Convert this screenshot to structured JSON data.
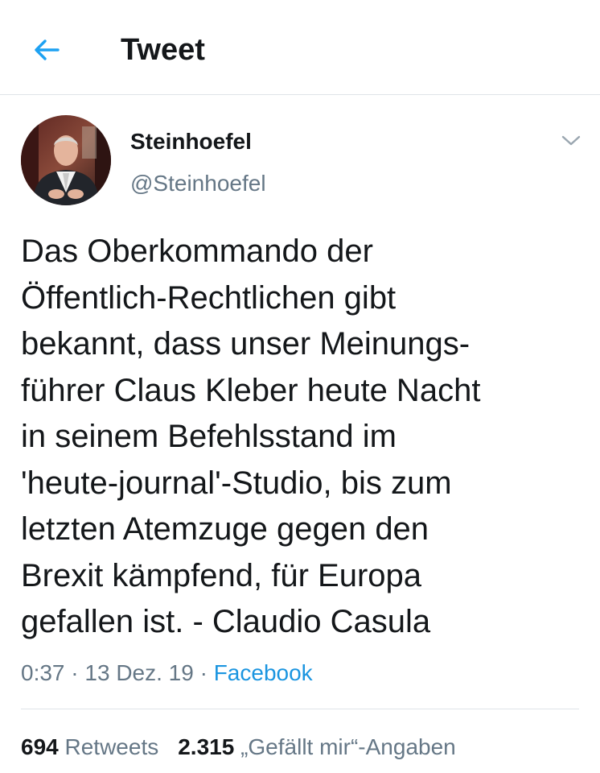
{
  "header": {
    "title": "Tweet",
    "back_icon": "arrow-left-icon",
    "accent_color": "#1da1f2"
  },
  "author": {
    "name": "Steinhoefel",
    "handle": "@Steinhoefel",
    "avatar_icon": "profile-photo",
    "menu_icon": "chevron-down-icon"
  },
  "tweet": {
    "text": "Das Oberkommando der\nÖffentlich-Rechtlichen gibt\nbekannt, dass unser Meinungs-\nführer Claus Kleber heute Nacht\nin seinem Befehlsstand im\n'heute-journal'-Studio, bis zum\nletzten Atemzuge gegen den\nBrexit kämpfend, für Europa\ngefallen ist. - Claudio Casula"
  },
  "meta": {
    "time": "0:37",
    "sep1": " · ",
    "date": "13 Dez. 19",
    "sep2": " · ",
    "source": "Facebook"
  },
  "stats": {
    "retweets_count": "694",
    "retweets_label": "Retweets",
    "likes_count": "2.315",
    "likes_label": "„Gefällt mir“-Angaben"
  }
}
